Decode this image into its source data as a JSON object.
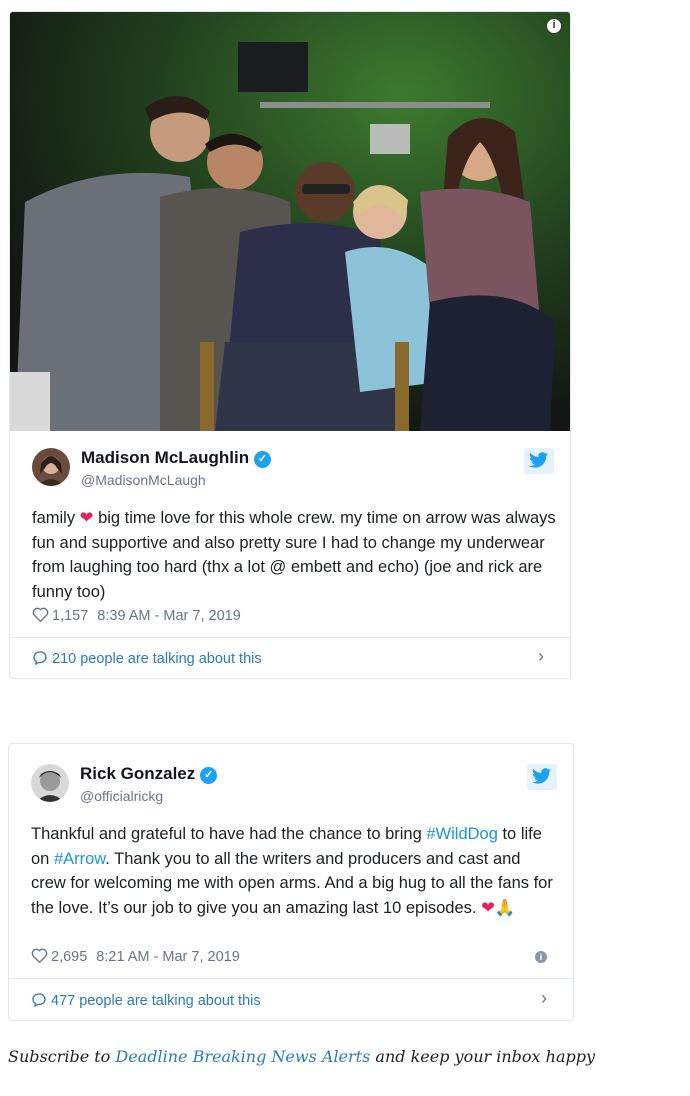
{
  "tweets": [
    {
      "name": "Madison McLaughlin",
      "handle": "@MadisonMcLaugh",
      "text_before": "family ",
      "emoji": "❤",
      "text_after": " big time love for this whole crew. my time on arrow was always fun and supportive and also pretty sure I had to change my underwear from laughing too hard (thx a lot @ embett and echo) (joe and rick are funny too)",
      "likes": "1,157",
      "timestamp": "8:39 AM - Mar 7, 2019",
      "talking": "210 people are talking about this"
    },
    {
      "name": "Rick Gonzalez",
      "handle": "@officialrickg",
      "text_1": "Thankful and grateful to have had the chance to bring ",
      "hashtag_1": "#WildDog",
      "text_2": " to life on ",
      "hashtag_2": "#Arrow",
      "text_3": ". Thank you to all the writers and producers and cast and crew for welcoming me with open arms. And a big hug to all the fans for the love. It’s our job to give you an amazing last 10 episodes. ",
      "emoji": "❤🙏",
      "likes": "2,695",
      "timestamp": "8:21 AM - Mar 7, 2019",
      "talking": "477 people are talking about this"
    }
  ],
  "info_icon": "i",
  "chevron": "›",
  "verified_mark": "✓",
  "subscribe": {
    "prefix": "Subscribe to ",
    "link": "Deadline Breaking News Alerts",
    "suffix": " and keep your inbox happy"
  },
  "colors": {
    "link_blue": "#1b95e0",
    "verified_blue": "#1da1f2",
    "muted": "#657786",
    "heart_red": "#e0245e"
  }
}
